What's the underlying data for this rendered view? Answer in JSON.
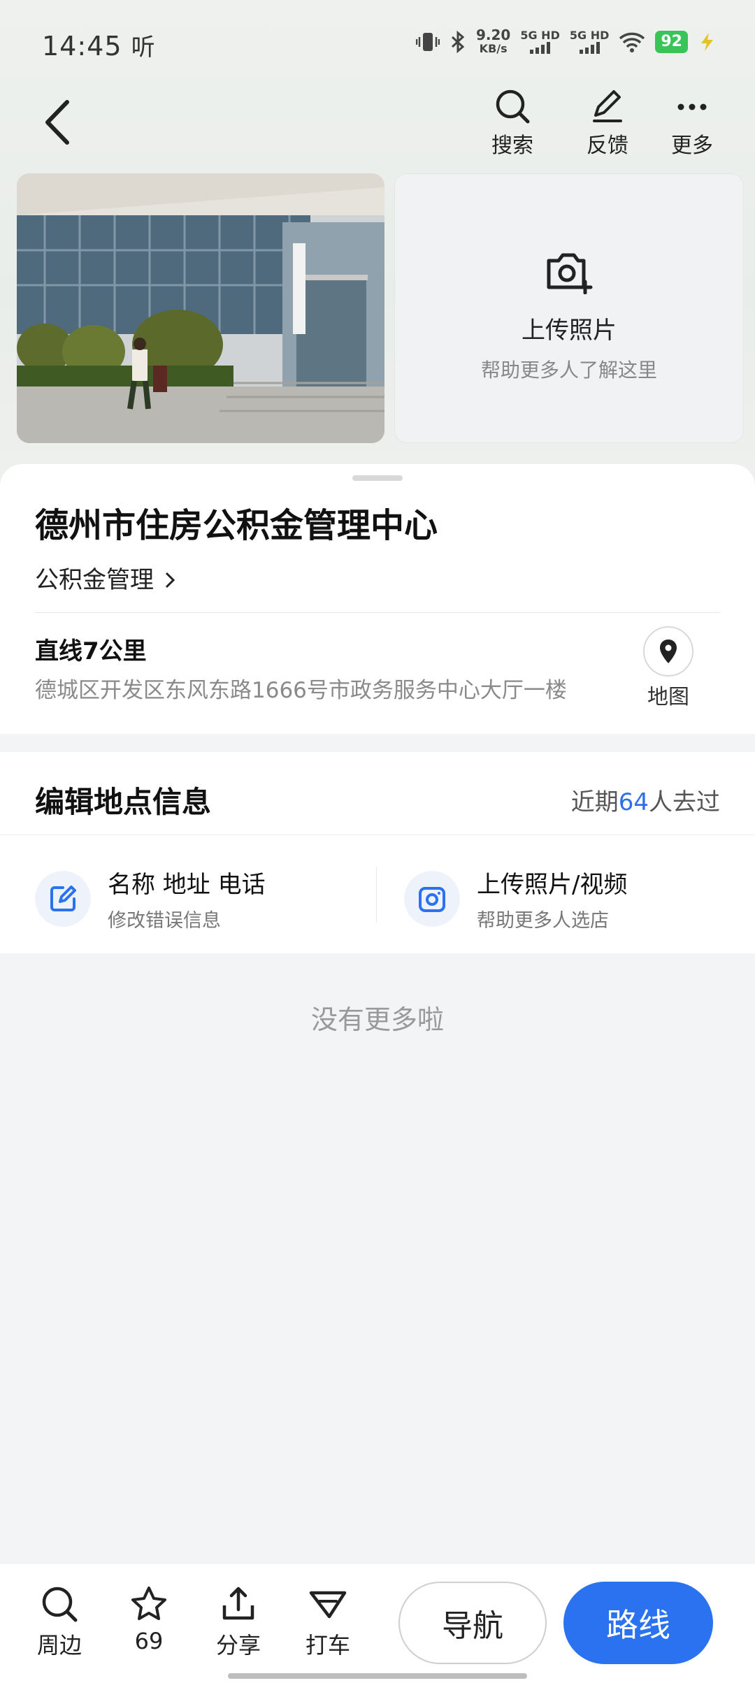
{
  "status_bar": {
    "time": "14:45",
    "status_text": "听",
    "net_speed_value": "9.20",
    "net_speed_unit": "KB/s",
    "sim1": "5G HD",
    "sim2": "5G HD",
    "battery": "92"
  },
  "header": {
    "actions": [
      {
        "label": "搜索",
        "icon": "search-icon"
      },
      {
        "label": "反馈",
        "icon": "edit-pen-icon"
      },
      {
        "label": "更多",
        "icon": "more-dots-icon"
      }
    ]
  },
  "photos": {
    "upload_title": "上传照片",
    "upload_subtitle": "帮助更多人了解这里"
  },
  "place": {
    "name": "德州市住房公积金管理中心",
    "category": "公积金管理",
    "distance": "直线7公里",
    "address": "德城区开发区东风东路1666号市政务服务中心大厅一楼",
    "map_label": "地图"
  },
  "edit": {
    "title": "编辑地点信息",
    "visited_prefix": "近期",
    "visited_count": "64",
    "visited_suffix": "人去过",
    "items": [
      {
        "title": "名称 地址 电话",
        "subtitle": "修改错误信息"
      },
      {
        "title": "上传照片/视频",
        "subtitle": "帮助更多人选店"
      }
    ]
  },
  "no_more": "没有更多啦",
  "bottom_bar": {
    "items": [
      {
        "label": "周边",
        "icon": "search-icon"
      },
      {
        "label": "69",
        "icon": "star-icon"
      },
      {
        "label": "分享",
        "icon": "share-icon"
      },
      {
        "label": "打车",
        "icon": "taxi-icon"
      }
    ],
    "navigate": "导航",
    "route": "路线"
  },
  "colors": {
    "accent": "#2a72f0",
    "battery": "#39c45a"
  }
}
